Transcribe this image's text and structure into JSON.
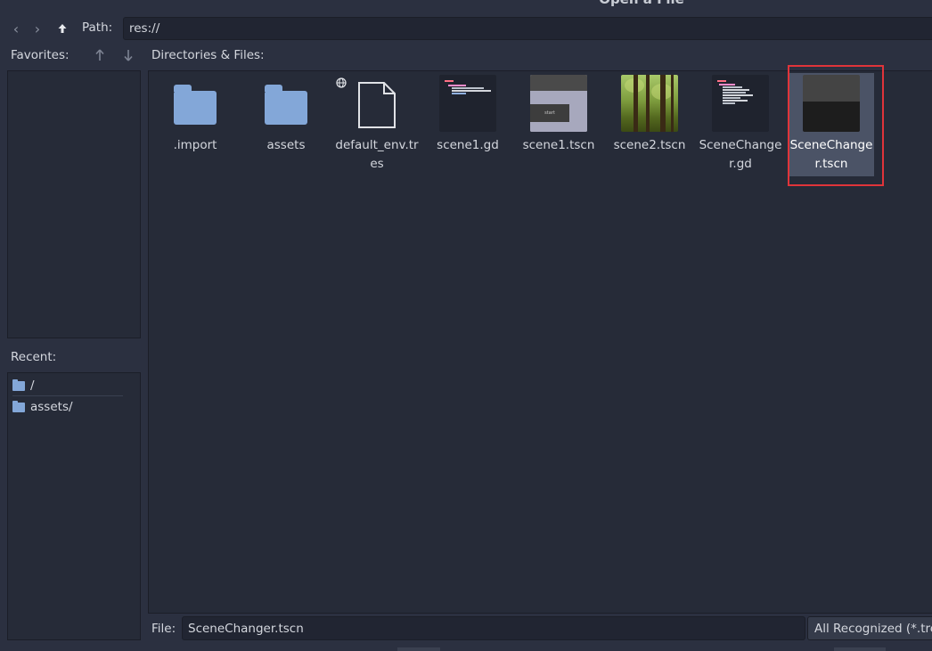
{
  "window": {
    "title": "Open a File"
  },
  "pathbar": {
    "back_icon": "chevron-left-icon",
    "forward_icon": "chevron-right-icon",
    "up_icon": "arrow-up-icon",
    "label": "Path:",
    "value": "res://"
  },
  "favorites": {
    "label": "Favorites:",
    "items": []
  },
  "recent": {
    "label": "Recent:",
    "items": [
      {
        "label": "/"
      },
      {
        "label": "assets/"
      }
    ]
  },
  "files": {
    "label": "Directories & Files:",
    "items": [
      {
        "name": ".import",
        "kind": "folder"
      },
      {
        "name": "assets",
        "kind": "folder"
      },
      {
        "name": "default_env.tres",
        "kind": "resource"
      },
      {
        "name": "scene1.gd",
        "kind": "script"
      },
      {
        "name": "scene1.tscn",
        "kind": "scene"
      },
      {
        "name": "scene2.tscn",
        "kind": "scene"
      },
      {
        "name": "SceneChanger.gd",
        "kind": "script"
      },
      {
        "name": "SceneChanger.tscn",
        "kind": "scene",
        "selected": true
      }
    ],
    "scene1_thumb_button": "start"
  },
  "footer": {
    "file_label": "File:",
    "file_value": "SceneChanger.tscn",
    "filter_value": "All Recognized (*.tres"
  },
  "colors": {
    "background": "#2b3040",
    "panel": "#262b38",
    "folder": "#83a7d8",
    "selection": "#4b5366",
    "highlight_box": "#e0343a"
  }
}
